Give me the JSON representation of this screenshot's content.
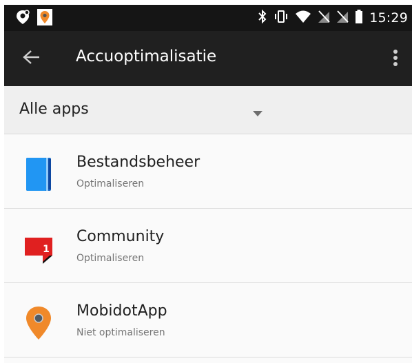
{
  "status_bar": {
    "time": "15:29",
    "icons_left": [
      "location-badge-icon",
      "mobidot-notification-icon"
    ],
    "icons_right": [
      "bluetooth-icon",
      "vibrate-icon",
      "wifi-icon",
      "no-sim-icon",
      "no-sim-icon",
      "battery-icon"
    ]
  },
  "toolbar": {
    "title": "Accuoptimalisatie",
    "back_icon": "arrow-back-icon",
    "overflow_icon": "more-vert-icon"
  },
  "filter": {
    "selected": "Alle apps",
    "dropdown_icon": "arrow-drop-down-icon"
  },
  "apps": [
    {
      "name": "Bestandsbeheer",
      "status": "Optimaliseren",
      "icon": "file-manager-icon"
    },
    {
      "name": "Community",
      "status": "Optimaliseren",
      "icon": "community-icon",
      "badge": "1"
    },
    {
      "name": "MobidotApp",
      "status": "Niet optimaliseren",
      "icon": "mobidot-pin-icon"
    }
  ],
  "colors": {
    "status_bar_bg": "#151515",
    "toolbar_bg": "#202020",
    "filter_bg": "#efefef",
    "list_bg": "#fafafa",
    "file_manager_blue": "#1976d2",
    "community_red": "#e02020",
    "mobidot_orange": "#f0892a"
  }
}
